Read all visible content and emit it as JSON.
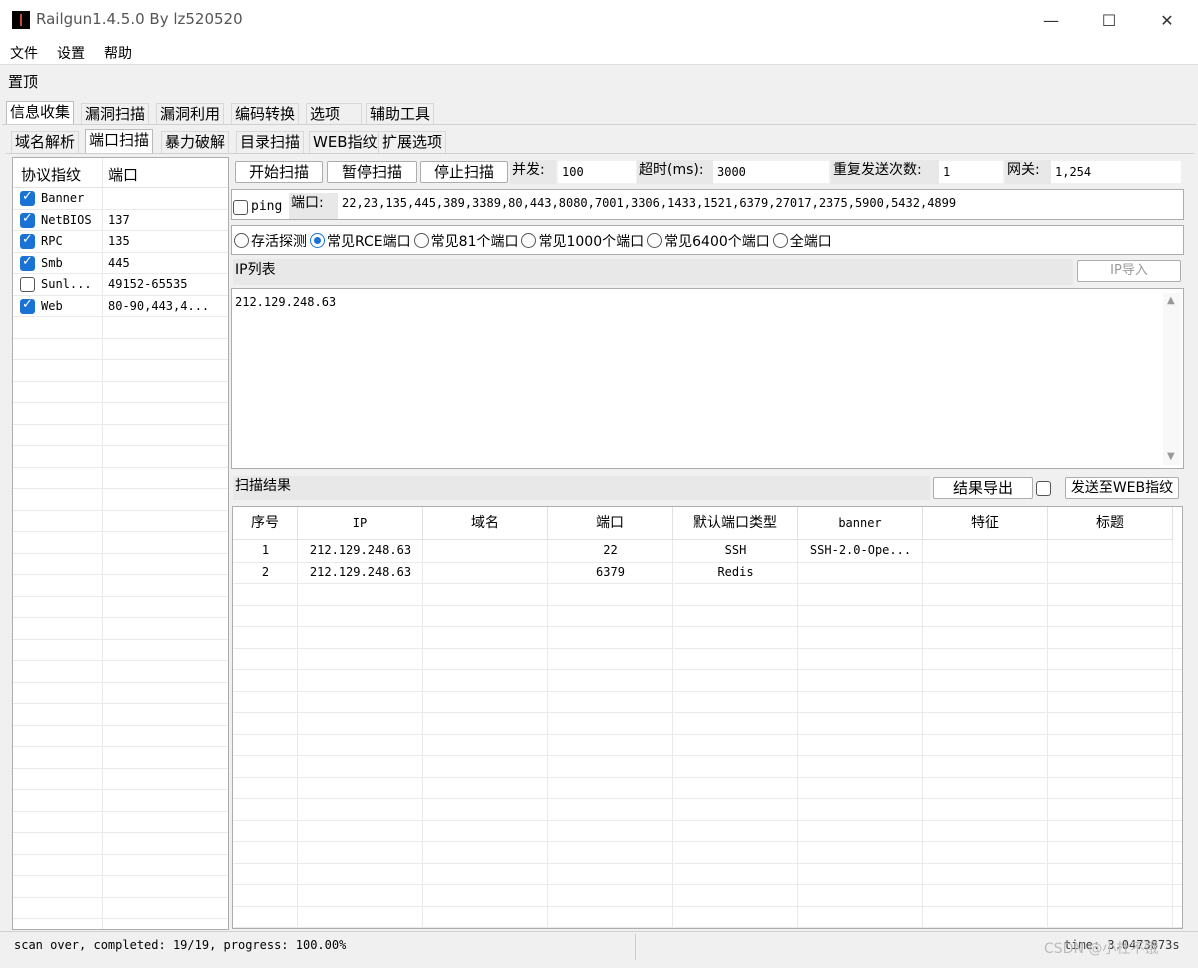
{
  "window": {
    "title": "Railgun1.4.5.0 By lz520520",
    "minimize": "—",
    "maximize": "☐",
    "close": "✕"
  },
  "menu": [
    "文件",
    "设置",
    "帮助"
  ],
  "pin_label": "置顶",
  "main_tabs": [
    "信息收集",
    "漏洞扫描",
    "漏洞利用",
    "编码转换",
    "选项",
    "辅助工具"
  ],
  "sub_tabs": [
    "域名解析",
    "端口扫描",
    "暴力破解",
    "目录扫描",
    "WEB指纹",
    "扩展选项"
  ],
  "protocol_table": {
    "headers": [
      "协议指纹",
      "端口"
    ],
    "rows": [
      {
        "name": "Banner",
        "port": "",
        "checked": true
      },
      {
        "name": "NetBIOS",
        "port": "137",
        "checked": true
      },
      {
        "name": "RPC",
        "port": "135",
        "checked": true
      },
      {
        "name": "Smb",
        "port": "445",
        "checked": true
      },
      {
        "name": "Sunl...",
        "port": "49152-65535",
        "checked": false
      },
      {
        "name": "Web",
        "port": "80-90,443,4...",
        "checked": true
      }
    ]
  },
  "controls": {
    "start": "开始扫描",
    "pause": "暂停扫描",
    "stop": "停止扫描",
    "concurrency_label": "并发:",
    "concurrency": "100",
    "timeout_label": "超时(ms):",
    "timeout": "3000",
    "retry_label": "重复发送次数:",
    "retry": "1",
    "gateway_label": "网关:",
    "gateway": "1,254",
    "ping_label": "ping",
    "port_label": "端口:",
    "ports": "22,23,135,445,389,3389,80,443,8080,7001,3306,1433,1521,6379,27017,2375,5900,5432,4899"
  },
  "port_presets": {
    "options": [
      "存活探测",
      "常见RCE端口",
      "常见81个端口",
      "常见1000个端口",
      "常见6400个端口",
      "全端口"
    ],
    "selected_index": 1
  },
  "ip_list": {
    "label": "IP列表",
    "import_button": "IP导入",
    "content": "212.129.248.63"
  },
  "scan_result": {
    "label": "扫描结果",
    "export_button": "结果导出",
    "send_button": "发送至WEB指纹",
    "headers": [
      "序号",
      "IP",
      "域名",
      "端口",
      "默认端口类型",
      "banner",
      "特征",
      "标题"
    ],
    "rows": [
      [
        "1",
        "212.129.248.63",
        "",
        "22",
        "SSH",
        "SSH-2.0-Ope...",
        "",
        ""
      ],
      [
        "2",
        "212.129.248.63",
        "",
        "6379",
        "Redis",
        "",
        "",
        ""
      ]
    ]
  },
  "status": {
    "text": "scan over, completed: 19/19, progress: 100.00%",
    "time": "time: 3.0473873s",
    "watermark": "CSDN @小杜不饿"
  }
}
